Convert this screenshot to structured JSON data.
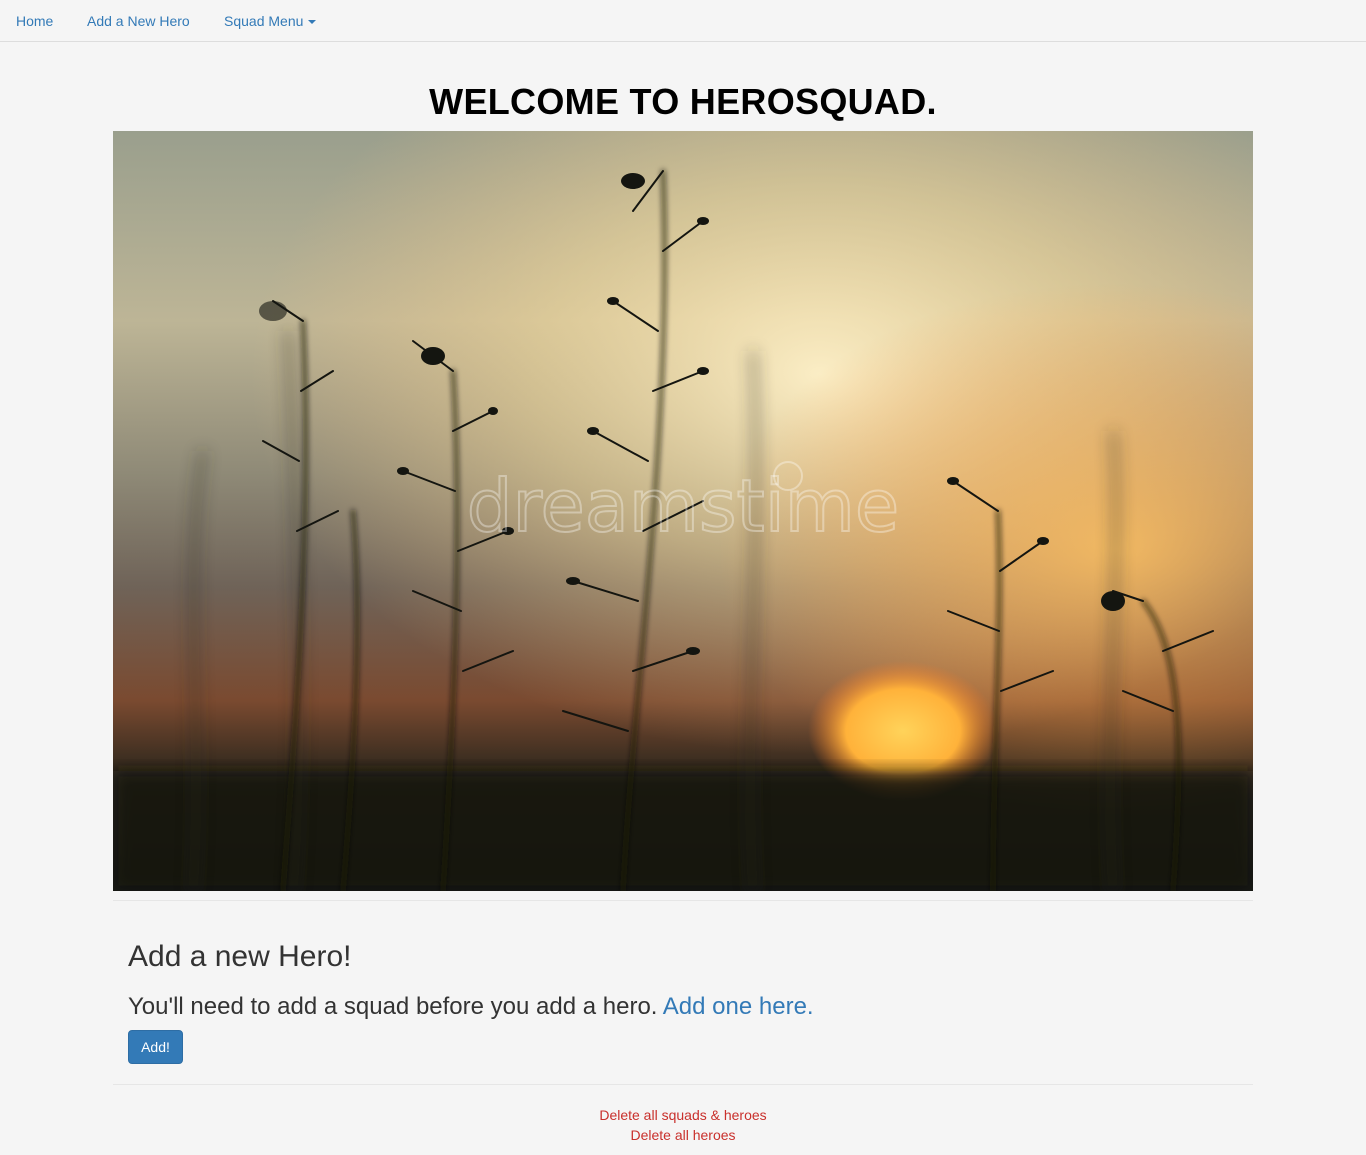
{
  "nav": {
    "home": "Home",
    "add_hero": "Add a New Hero",
    "squad_menu": "Squad Menu"
  },
  "page": {
    "title": "WELCOME TO HEROSQUAD."
  },
  "hero_image": {
    "watermark": "dreamstime"
  },
  "add_section": {
    "heading": "Add a new Hero!",
    "notice": "You'll need to add a squad before you add a hero. ",
    "notice_link": "Add one here.",
    "button": "Add!"
  },
  "footer": {
    "delete_all": "Delete all squads & heroes",
    "delete_heroes": "Delete all heroes"
  },
  "colors": {
    "link": "#337ab7",
    "danger": "#c9302c",
    "button": "#337ab7",
    "background": "#f5f5f5"
  }
}
